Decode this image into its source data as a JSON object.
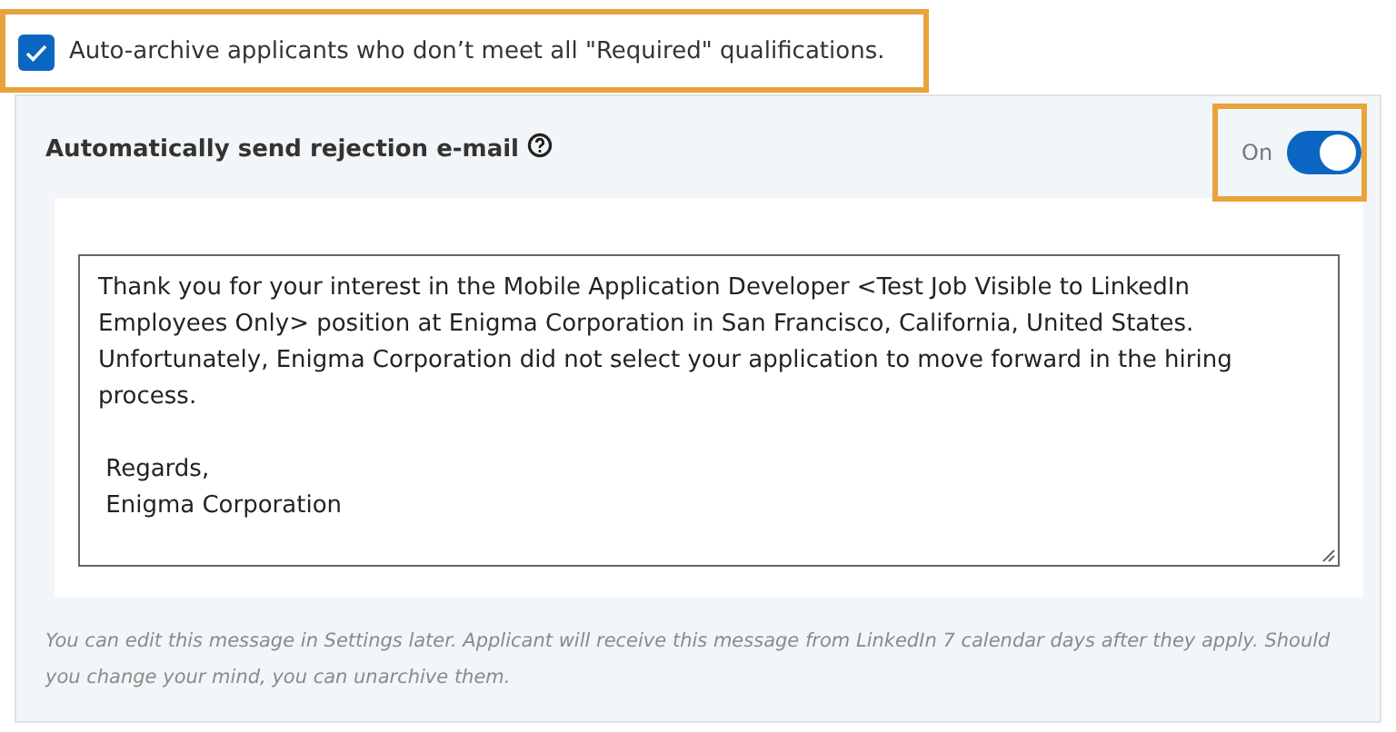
{
  "auto_archive": {
    "label": "Auto-archive applicants who don’t meet all \"Required\" qualifications.",
    "checked": true
  },
  "rejection_email": {
    "title": "Automatically send rejection e-mail",
    "toggle": {
      "label": "On",
      "on": true
    },
    "message": "Thank you for your interest in the Mobile Application Developer <Test Job Visible to LinkedIn Employees Only> position at Enigma Corporation in San Francisco, California, United States. Unfortunately, Enigma Corporation did not select your application to move forward in the hiring process.\n\n Regards,\n Enigma Corporation",
    "note": "You can edit this message in Settings later. Applicant will receive this message from LinkedIn 7 calendar days after they apply. Should you change your mind, you can unarchive them."
  }
}
